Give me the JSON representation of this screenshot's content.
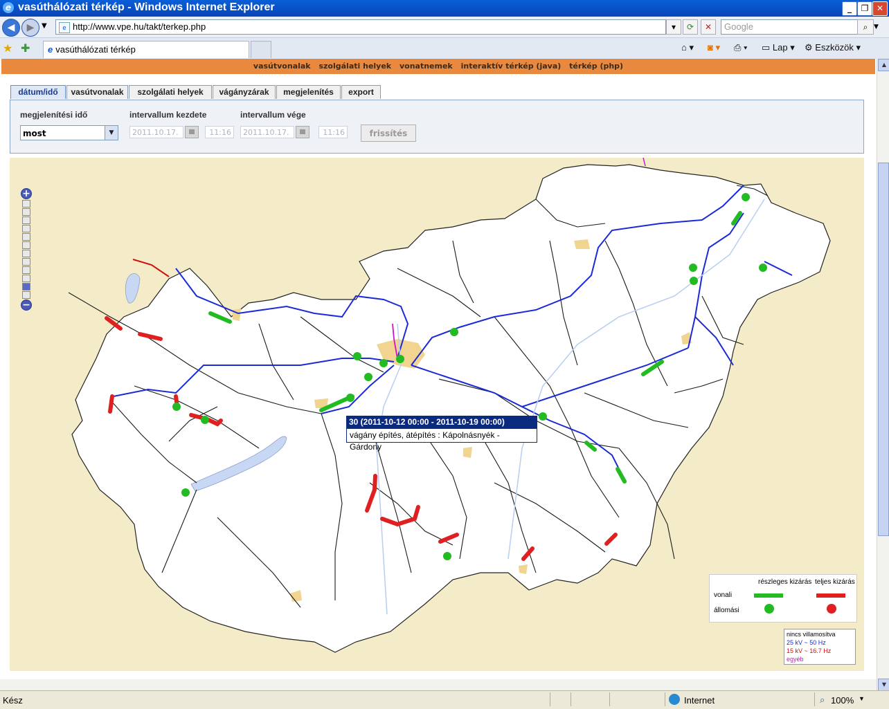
{
  "window": {
    "title": "vasúthálózati térkép - Windows Internet Explorer"
  },
  "addressbar": {
    "url": "http://www.vpe.hu/takt/terkep.php",
    "search_placeholder": "Google"
  },
  "browser_tab": {
    "label": "vasúthálózati térkép"
  },
  "commandbar": {
    "page_label": "Lap",
    "tools_label": "Eszközök"
  },
  "topnav": [
    "vasútvonalak",
    "szolgálati helyek",
    "vonatnemek",
    "interaktív térkép (java)",
    "térkép (php)"
  ],
  "tabs": [
    "dátum/idő",
    "vasútvonalak",
    "szolgálati helyek",
    "vágányzárak",
    "megjelenítés",
    "export"
  ],
  "form": {
    "display_time_label": "megjelenítési idő",
    "display_time_value": "most",
    "interval_start_label": "intervallum kezdete",
    "interval_end_label": "intervallum vége",
    "start_date": "2011.10.17.",
    "start_time": "11:16",
    "end_date": "2011.10.17.",
    "end_time": "11:16",
    "refresh_label": "frissítés"
  },
  "tooltip": {
    "title": "30 (2011-10-12 00:00 - 2011-10-19 00:00)",
    "body": "vágány építés, átépítés : Kápolnásnyék - Gárdony"
  },
  "legend": {
    "partial": "részleges kizárás",
    "full": "teljes kizárás",
    "line_row": "vonali",
    "station_row": "állomási",
    "partial_color": "#22bb22",
    "full_color": "#e02020"
  },
  "electrification_legend": [
    {
      "label": "nincs villamosítva",
      "color": "#000000"
    },
    {
      "label": "25 kV ~ 50 Hz",
      "color": "#1a2ad8"
    },
    {
      "label": "15 kV ~ 16.7 Hz",
      "color": "#d01010"
    },
    {
      "label": "egyéb",
      "color": "#d010d0"
    }
  ],
  "status": {
    "left": "Kész",
    "zone": "Internet",
    "zoom": "100%"
  }
}
